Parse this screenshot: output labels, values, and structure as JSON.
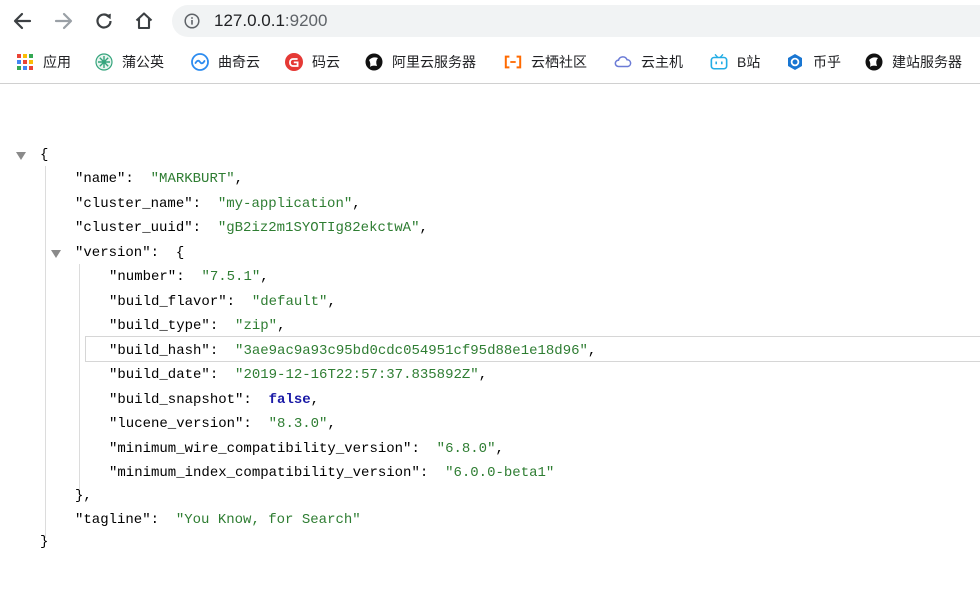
{
  "browser": {
    "url_host": "127.0.0.1",
    "url_port": ":9200",
    "icons": [
      "back-icon",
      "forward-icon",
      "reload-icon",
      "home-icon",
      "info-icon"
    ]
  },
  "bookmarks": [
    {
      "label": "应用",
      "icon": "apps-grid-icon",
      "color": "#e94235"
    },
    {
      "label": "蒲公英",
      "icon": "dandelion-icon",
      "color": "#34a47c"
    },
    {
      "label": "曲奇云",
      "icon": "cookie-cloud-icon",
      "color": "#2d8cf0"
    },
    {
      "label": "码云",
      "icon": "gitee-icon",
      "color": "#e53935"
    },
    {
      "label": "阿里云服务器",
      "icon": "aliyun-icon",
      "color": "#111111"
    },
    {
      "label": "云栖社区",
      "icon": "yunqi-icon",
      "color": "#ff6a00"
    },
    {
      "label": "云主机",
      "icon": "cloud-host-icon",
      "color": "#6b7bd6"
    },
    {
      "label": "B站",
      "icon": "bilibili-icon",
      "color": "#23ade5"
    },
    {
      "label": "币乎",
      "icon": "bihu-icon",
      "color": "#1976d2"
    },
    {
      "label": "建站服务器",
      "icon": "server-icon",
      "color": "#111111"
    }
  ],
  "json": {
    "open_brace": "{",
    "close_brace": "}",
    "name": {
      "key": "\"name\"",
      "value": "\"MARKBURT\""
    },
    "cluster_name": {
      "key": "\"cluster_name\"",
      "value": "\"my-application\""
    },
    "cluster_uuid": {
      "key": "\"cluster_uuid\"",
      "value": "\"gB2iz2m1SYOTIg82ekctwA\""
    },
    "version": {
      "key": "\"version\"",
      "open": "{",
      "close": "},",
      "number": {
        "key": "\"number\"",
        "value": "\"7.5.1\""
      },
      "build_flavor": {
        "key": "\"build_flavor\"",
        "value": "\"default\""
      },
      "build_type": {
        "key": "\"build_type\"",
        "value": "\"zip\""
      },
      "build_hash": {
        "key": "\"build_hash\"",
        "value": "\"3ae9ac9a93c95bd0cdc054951cf95d88e1e18d96\""
      },
      "build_date": {
        "key": "\"build_date\"",
        "value": "\"2019-12-16T22:57:37.835892Z\""
      },
      "build_snapshot": {
        "key": "\"build_snapshot\"",
        "value": "false"
      },
      "lucene_version": {
        "key": "\"lucene_version\"",
        "value": "\"8.3.0\""
      },
      "minimum_wire_compatibility_version": {
        "key": "\"minimum_wire_compatibility_version\"",
        "value": "\"6.8.0\""
      },
      "minimum_index_compatibility_version": {
        "key": "\"minimum_index_compatibility_version\"",
        "value": "\"6.0.0-beta1\""
      }
    },
    "tagline": {
      "key": "\"tagline\"",
      "value": "\"You Know, for Search\""
    }
  }
}
